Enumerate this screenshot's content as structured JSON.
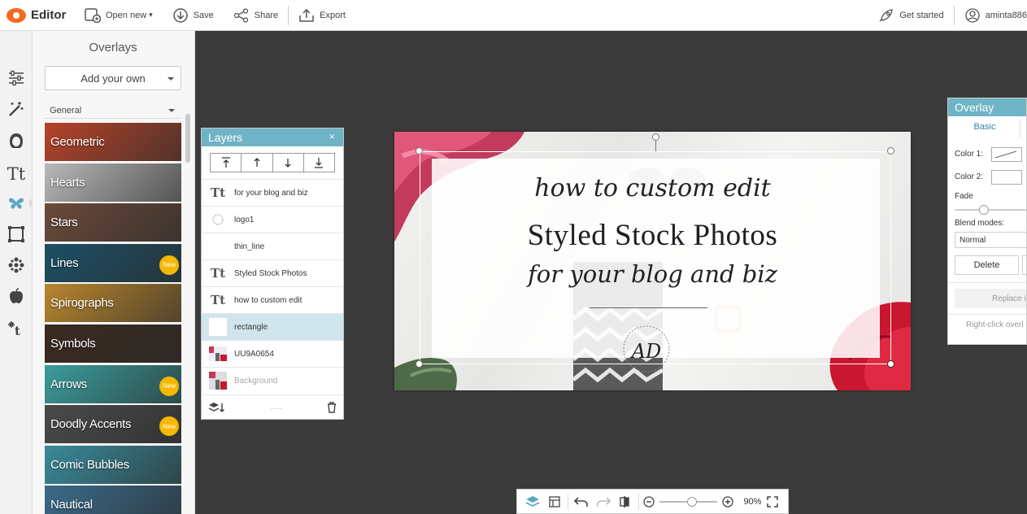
{
  "app": {
    "name": "Editor",
    "brand_color": "#f26b21",
    "accent_color": "#6fb3c6"
  },
  "topbar": {
    "open_new": "Open new",
    "save": "Save",
    "share": "Share",
    "export": "Export",
    "get_started": "Get started",
    "user": "aminta886"
  },
  "rail": {
    "icons": [
      "adjustments-icon",
      "effects-wand-icon",
      "touch-up-face-icon",
      "text-icon",
      "overlays-butterfly-icon",
      "frames-icon",
      "textures-icon",
      "themes-apple-icon",
      "design-icon"
    ],
    "active": "overlays-butterfly-icon"
  },
  "overlays_panel": {
    "title": "Overlays",
    "add_own": "Add your own",
    "category": "General",
    "items": [
      {
        "label": "Geometric",
        "badge": "",
        "color": "#b5442a"
      },
      {
        "label": "Hearts",
        "badge": "",
        "color": "#b9b9b9"
      },
      {
        "label": "Stars",
        "badge": "",
        "color": "#6b4a3a"
      },
      {
        "label": "Lines",
        "badge": "New",
        "color": "#1c4f66"
      },
      {
        "label": "Spirographs",
        "badge": "",
        "color": "#b8862e"
      },
      {
        "label": "Symbols",
        "badge": "",
        "color": "#3a2a20"
      },
      {
        "label": "Arrows",
        "badge": "New",
        "color": "#3a9c9c"
      },
      {
        "label": "Doodly Accents",
        "badge": "New",
        "color": "#4a4a4a"
      },
      {
        "label": "Comic Bubbles",
        "badge": "",
        "color": "#3a8a9a"
      },
      {
        "label": "Nautical",
        "badge": "",
        "color": "#3a6a8a"
      }
    ]
  },
  "layers_panel": {
    "title": "Layers",
    "close": "×",
    "footer_dots": ".....",
    "rows": [
      {
        "name": "for your blog and biz",
        "kind": "text",
        "selected": false,
        "dim": false
      },
      {
        "name": "logo1",
        "kind": "logo",
        "selected": false,
        "dim": false
      },
      {
        "name": "thin_line",
        "kind": "line",
        "selected": false,
        "dim": false
      },
      {
        "name": "Styled Stock Photos",
        "kind": "text",
        "selected": false,
        "dim": false
      },
      {
        "name": "how to custom edit",
        "kind": "text",
        "selected": false,
        "dim": false
      },
      {
        "name": "rectangle",
        "kind": "rect",
        "selected": true,
        "dim": false
      },
      {
        "name": "UU9A0654",
        "kind": "photo",
        "selected": false,
        "dim": false
      },
      {
        "name": "Background",
        "kind": "bg",
        "selected": false,
        "dim": true
      }
    ]
  },
  "canvas": {
    "line1": "how to custom edit",
    "line2": "Styled Stock Photos",
    "line3": "for your blog and biz",
    "logo": "AD"
  },
  "overlay_settings": {
    "title": "Overlay",
    "tab_basic": "Basic",
    "color1_label": "Color 1:",
    "color2_label": "Color 2:",
    "fade_label": "Fade",
    "blend_label": "Blend modes:",
    "blend_value": "Normal",
    "delete_label": "Delete",
    "replace_label": "Replace i",
    "hint": "Right-click overl option"
  },
  "bottom_toolbar": {
    "zoom": "90%"
  }
}
